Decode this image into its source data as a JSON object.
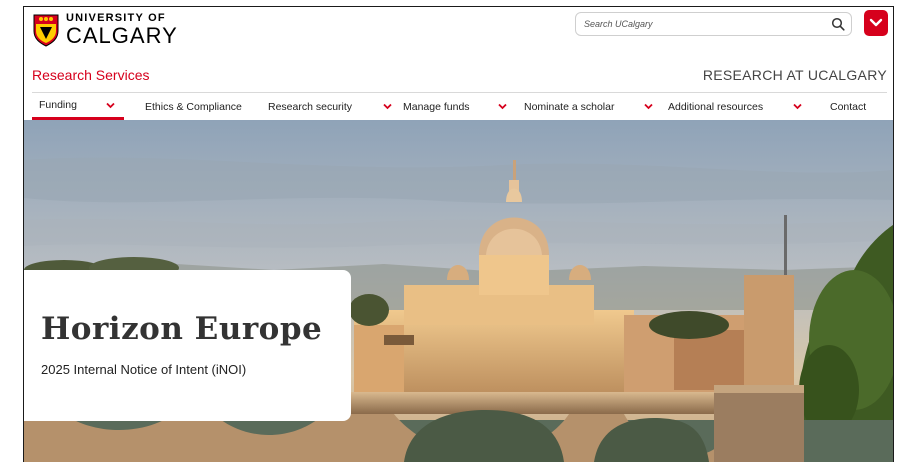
{
  "header": {
    "logo_line1": "UNIVERSITY OF",
    "logo_line2": "CALGARY",
    "search_placeholder": "Search UCalgary",
    "site_title": "Research Services",
    "research_link": "RESEARCH AT UCALGARY"
  },
  "nav": {
    "items": [
      {
        "label": "Funding",
        "dropdown": true
      },
      {
        "label": "Ethics & Compliance",
        "dropdown": false
      },
      {
        "label": "Research security",
        "dropdown": true
      },
      {
        "label": "Manage funds",
        "dropdown": true
      },
      {
        "label": "Nominate a scholar",
        "dropdown": true
      },
      {
        "label": "Additional resources",
        "dropdown": true
      },
      {
        "label": "Contact",
        "dropdown": false
      }
    ]
  },
  "hero": {
    "title": "Horizon Europe",
    "subtitle": "2025 Internal Notice of Intent (iNOI)"
  },
  "colors": {
    "brand_red": "#d6001c",
    "accent_gold": "#ffcd00"
  },
  "icons": {
    "search": "search-icon",
    "menu": "chevron-down-icon",
    "logo": "university-shield-icon"
  }
}
